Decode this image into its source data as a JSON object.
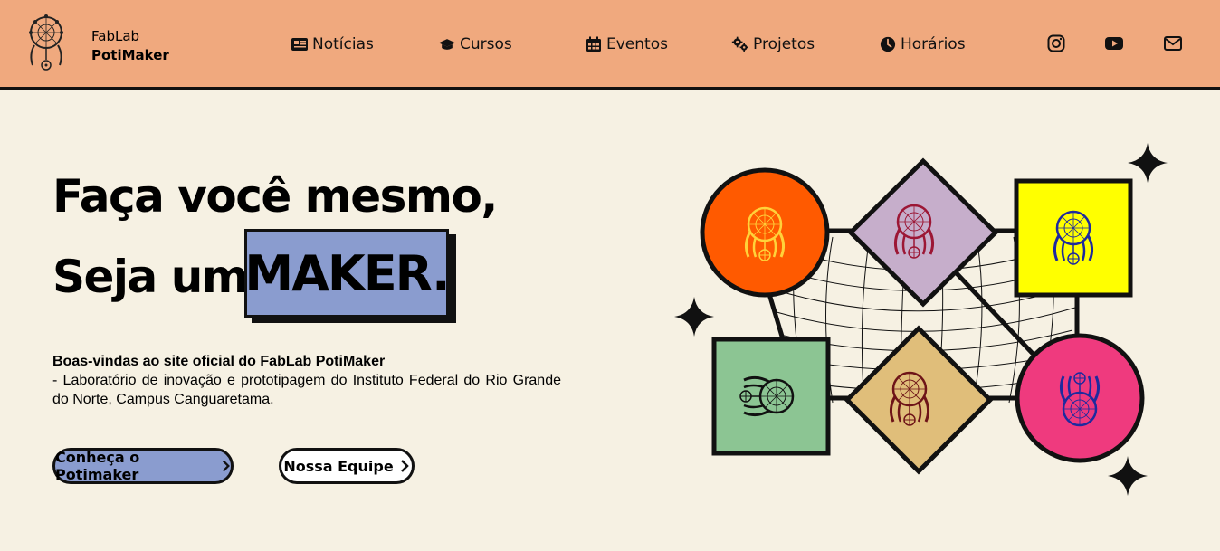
{
  "brand": {
    "line1": "FabLab",
    "line2": "PotiMaker",
    "logo_icon": "dreamcatcher-logo"
  },
  "nav": [
    {
      "label": "Notícias",
      "icon": "newspaper-icon"
    },
    {
      "label": "Cursos",
      "icon": "graduation-cap-icon"
    },
    {
      "label": "Eventos",
      "icon": "calendar-icon"
    },
    {
      "label": "Projetos",
      "icon": "gears-icon"
    },
    {
      "label": "Horários",
      "icon": "clock-icon"
    }
  ],
  "social": [
    {
      "name": "instagram-icon"
    },
    {
      "name": "youtube-icon"
    },
    {
      "name": "email-icon"
    }
  ],
  "hero": {
    "line1": "Faça você mesmo,",
    "line2_prefix": "Seja um",
    "highlight": "MAKER."
  },
  "welcome": {
    "title": "Boas-vindas ao site oficial do FabLab PotiMaker",
    "text": "- Laboratório de inovação e prototipagem do Instituto Federal do Rio Grande do Norte, Campus Canguaretama."
  },
  "buttons": {
    "primary": "Conheça o Potimaker",
    "secondary": "Nossa Equipe"
  },
  "colors": {
    "header_bg": "#f0a97e",
    "page_bg": "#f6f1e3",
    "accent_blue": "#8a9ccf",
    "orange": "#ff5a00",
    "lilac": "#c6aecb",
    "yellow": "#ffff00",
    "green": "#8cc593",
    "tan": "#e0be7a",
    "pink": "#ef3a7e"
  }
}
